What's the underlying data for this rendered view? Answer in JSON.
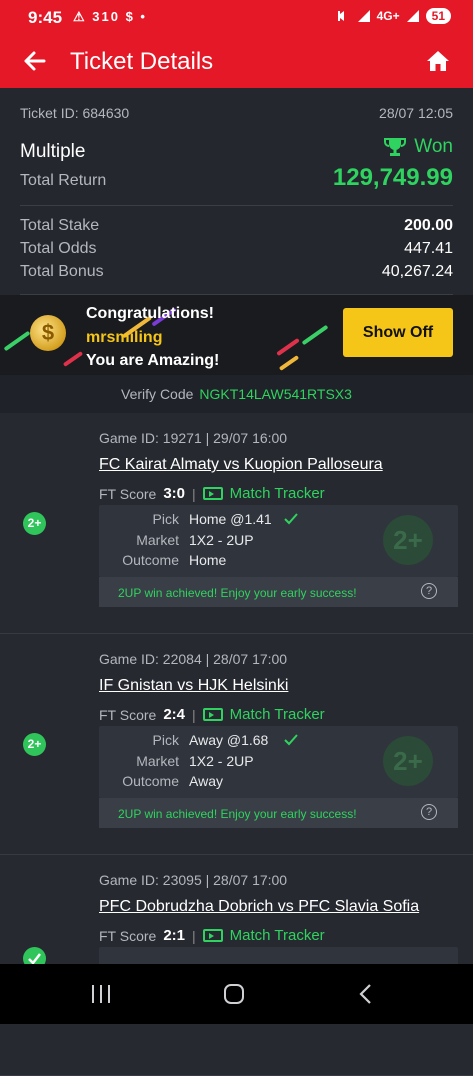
{
  "status_bar": {
    "time": "9:45",
    "left_icons": "⚠ 310 $ •",
    "network": "4G+",
    "battery": "51"
  },
  "header": {
    "title": "Ticket Details"
  },
  "ticket": {
    "id_label": "Ticket ID: 684630",
    "datetime": "28/07 12:05",
    "type": "Multiple",
    "status": "Won",
    "total_return_label": "Total Return",
    "total_return": "129,749.99",
    "total_stake_label": "Total Stake",
    "total_stake": "200.00",
    "total_odds_label": "Total Odds",
    "total_odds": "447.41",
    "total_bonus_label": "Total Bonus",
    "total_bonus": "40,267.24"
  },
  "banner": {
    "line1": "Congratulations!",
    "username": "mrsmiling",
    "line3": "You are Amazing!",
    "button": "Show Off"
  },
  "verify": {
    "label": "Verify Code",
    "code": "NGKT14LAW541RTSX3"
  },
  "games": [
    {
      "game_id": "Game ID: 19271 | 29/07 16:00",
      "teams": "FC Kairat Almaty vs Kuopion Palloseura",
      "ft_label": "FT Score",
      "score": "3:0",
      "tracker": "Match Tracker",
      "badge": "2+",
      "pick_label": "Pick",
      "pick": "Home @1.41",
      "market_label": "Market",
      "market": "1X2 - 2UP",
      "outcome_label": "Outcome",
      "outcome": "Home",
      "watermark": "2+",
      "message": "2UP win achieved! Enjoy your early success!"
    },
    {
      "game_id": "Game ID: 22084 | 28/07 17:00",
      "teams": "IF Gnistan vs HJK Helsinki",
      "ft_label": "FT Score",
      "score": "2:4",
      "tracker": "Match Tracker",
      "badge": "2+",
      "pick_label": "Pick",
      "pick": "Away @1.68",
      "market_label": "Market",
      "market": "1X2 - 2UP",
      "outcome_label": "Outcome",
      "outcome": "Away",
      "watermark": "2+",
      "message": "2UP win achieved! Enjoy your early success!"
    },
    {
      "game_id": "Game ID: 23095 | 28/07 17:00",
      "teams": "PFC Dobrudzha Dobrich vs PFC Slavia Sofia",
      "ft_label": "FT Score",
      "score": "2:1",
      "tracker": "Match Tracker"
    }
  ],
  "colors": {
    "brand_red": "#e41827",
    "win_green": "#2fd35f",
    "button_yellow": "#f5c518"
  }
}
